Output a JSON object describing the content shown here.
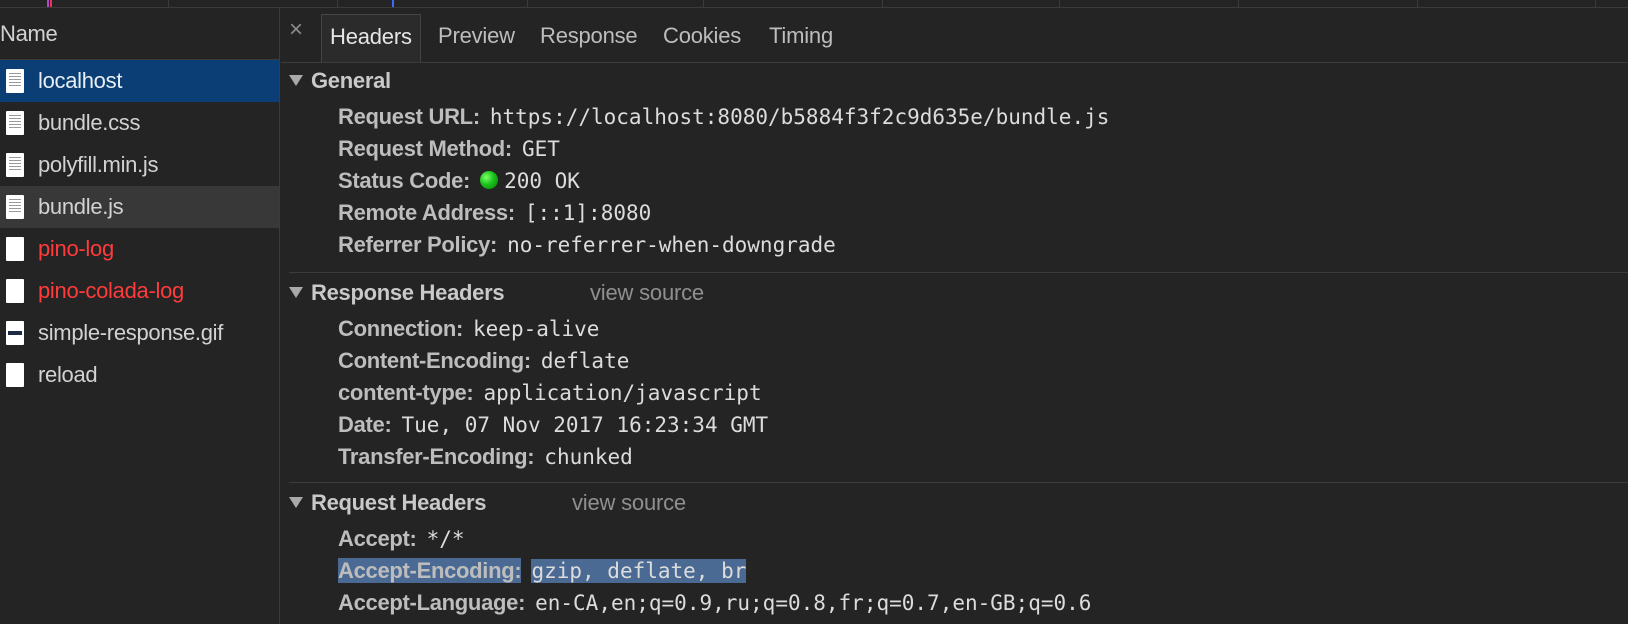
{
  "timeline": {},
  "sidebar": {
    "header": "Name",
    "items": [
      {
        "label": "localhost",
        "state": "selected",
        "icon": "document-icon",
        "error": false
      },
      {
        "label": "bundle.css",
        "state": "normal",
        "icon": "document-icon",
        "error": false
      },
      {
        "label": "polyfill.min.js",
        "state": "normal",
        "icon": "document-icon",
        "error": false
      },
      {
        "label": "bundle.js",
        "state": "hover",
        "icon": "document-icon",
        "error": false
      },
      {
        "label": "pino-log",
        "state": "normal",
        "icon": "blank-file-icon",
        "error": true
      },
      {
        "label": "pino-colada-log",
        "state": "normal",
        "icon": "blank-file-icon",
        "error": true
      },
      {
        "label": "simple-response.gif",
        "state": "normal",
        "icon": "image-icon",
        "error": false
      },
      {
        "label": "reload",
        "state": "normal",
        "icon": "blank-file-icon",
        "error": false
      }
    ]
  },
  "tabs": {
    "close": "×",
    "items": [
      "Headers",
      "Preview",
      "Response",
      "Cookies",
      "Timing"
    ],
    "active": "Headers"
  },
  "general": {
    "title": "General",
    "rows": [
      {
        "key": "Request URL:",
        "value": "https://localhost:8080/b5884f3f2c9d635e/bundle.js"
      },
      {
        "key": "Request Method:",
        "value": "GET"
      },
      {
        "key": "Status Code:",
        "value": "200 OK"
      },
      {
        "key": "Remote Address:",
        "value": "[::1]:8080"
      },
      {
        "key": "Referrer Policy:",
        "value": "no-referrer-when-downgrade"
      }
    ]
  },
  "response_headers": {
    "title": "Response Headers",
    "view_source": "view source",
    "rows": [
      {
        "key": "Connection:",
        "value": "keep-alive"
      },
      {
        "key": "Content-Encoding:",
        "value": "deflate"
      },
      {
        "key": "content-type:",
        "value": "application/javascript"
      },
      {
        "key": "Date:",
        "value": "Tue, 07 Nov 2017 16:23:34 GMT"
      },
      {
        "key": "Transfer-Encoding:",
        "value": "chunked"
      }
    ]
  },
  "request_headers": {
    "title": "Request Headers",
    "view_source": "view source",
    "rows": [
      {
        "key": "Accept:",
        "value": "*/*"
      },
      {
        "key": "Accept-Encoding:",
        "value": "gzip, deflate, br"
      },
      {
        "key": "Accept-Language:",
        "value": "en-CA,en;q=0.9,ru;q=0.8,fr;q=0.7,en-GB;q=0.6"
      }
    ]
  },
  "colors": {
    "selection": "#0b3e74",
    "error_text": "#ff3b3b",
    "text_highlight": "#4a6a94",
    "status_ok": "#19c21a"
  }
}
